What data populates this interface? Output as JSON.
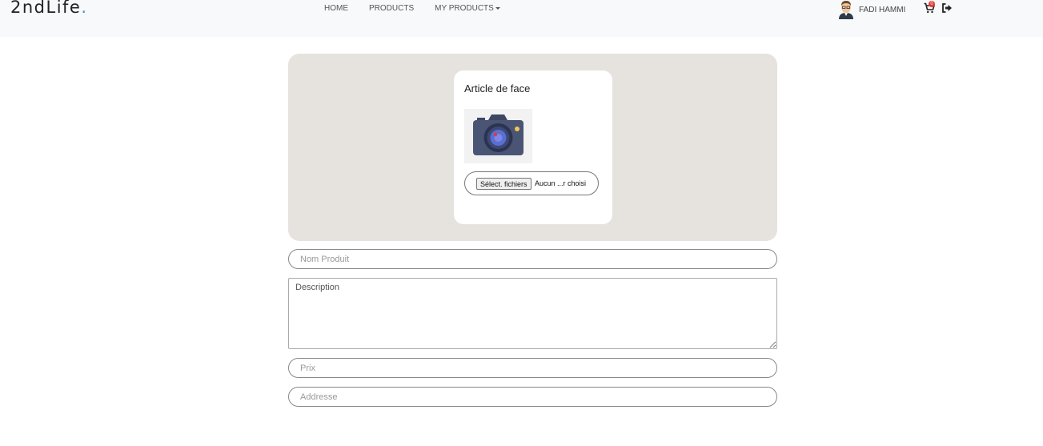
{
  "brand": {
    "name": "2ndLife",
    "dot": "."
  },
  "nav": {
    "home": "HOME",
    "products": "PRODUCTS",
    "my_products": "MY PRODUCTS"
  },
  "user": {
    "name": "FADI HAMMI"
  },
  "cart": {
    "badge": "0",
    "icon": "cart-icon"
  },
  "logout": {
    "icon": "sign-out-icon"
  },
  "upload": {
    "card_title": "Article de face",
    "image_icon": "camera-icon",
    "file_button": "Sélect. fichiers",
    "file_status": "Aucun ...r choisi"
  },
  "form": {
    "name_placeholder": "Nom Produit",
    "description_placeholder": "Description",
    "price_placeholder": "Prix",
    "address_placeholder": "Addresse"
  },
  "colors": {
    "navbar_bg": "#f8f9fa",
    "panel_bg": "#e6e3df",
    "brand_dot": "#4a90e2",
    "badge": "#e53935"
  }
}
